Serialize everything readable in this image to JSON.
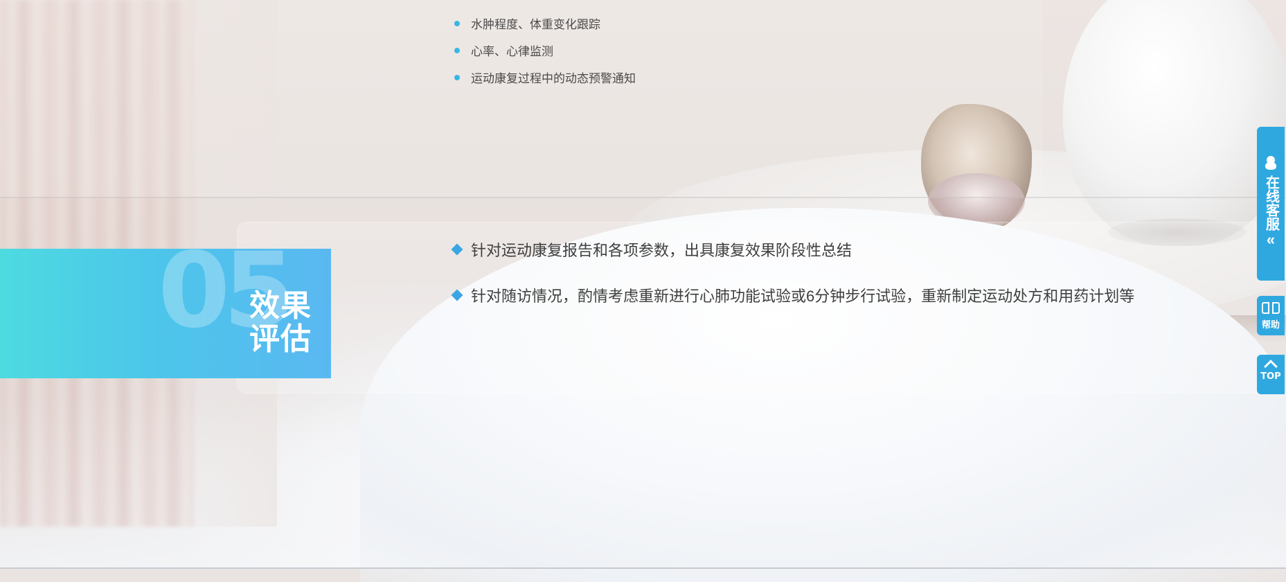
{
  "section_prev": {
    "bullets": [
      "水肿程度、体重变化跟踪",
      "心率、心律监测",
      "运动康复过程中的动态预警通知"
    ]
  },
  "section": {
    "number": "05",
    "title_line1": "效果",
    "title_line2": "评估",
    "points": [
      "针对运动康复报告和各项参数，出具康复效果阶段性总结",
      "针对随访情况，酌情考虑重新进行心肺功能试验或6分钟步行试验，重新制定运动处方和用药计划等"
    ]
  },
  "sidebar": {
    "customer_service_label": "在线客服",
    "collapse_glyph": "«",
    "help_label": "帮助",
    "top_label": "TOP"
  },
  "colors": {
    "accent": "#2fa8e0",
    "badge_start": "#4ddbe0",
    "badge_end": "#5ab8f1",
    "bullet_dot": "#3ab6e6"
  },
  "icons": [
    "qq-icon",
    "book-icon",
    "caret-up-icon",
    "double-chevron-left-icon",
    "diamond-bullet-icon"
  ]
}
